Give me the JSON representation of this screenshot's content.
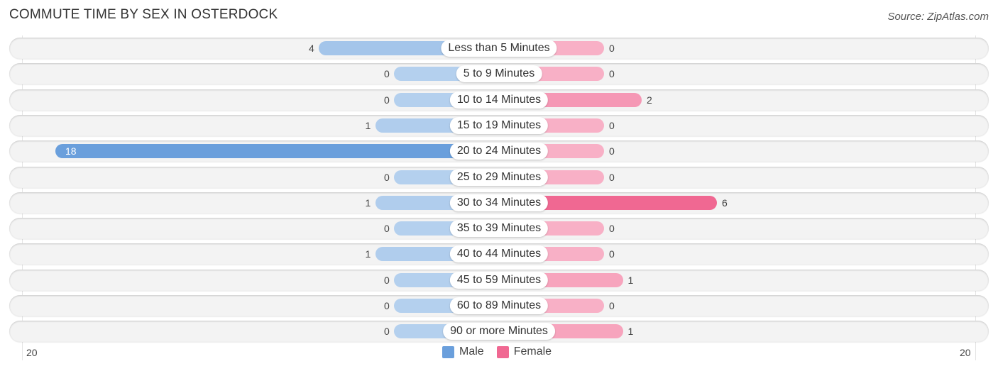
{
  "title": "COMMUTE TIME BY SEX IN OSTERDOCK",
  "source": "Source: ZipAtlas.com",
  "chart_data": {
    "type": "bar",
    "orientation": "horizontal-diverging",
    "title": "COMMUTE TIME BY SEX IN OSTERDOCK",
    "categories": [
      "Less than 5 Minutes",
      "5 to 9 Minutes",
      "10 to 14 Minutes",
      "15 to 19 Minutes",
      "20 to 24 Minutes",
      "25 to 29 Minutes",
      "30 to 34 Minutes",
      "35 to 39 Minutes",
      "40 to 44 Minutes",
      "45 to 59 Minutes",
      "60 to 89 Minutes",
      "90 or more Minutes"
    ],
    "series": [
      {
        "name": "Male",
        "color": "#6a9fdc",
        "values": [
          4,
          0,
          0,
          1,
          18,
          0,
          1,
          0,
          1,
          0,
          0,
          0
        ]
      },
      {
        "name": "Female",
        "color": "#f06892",
        "values": [
          0,
          0,
          2,
          0,
          0,
          0,
          6,
          0,
          0,
          1,
          0,
          1
        ]
      }
    ],
    "axis_min_label": "20",
    "axis_max_label": "20",
    "xlim": [
      -20,
      20
    ],
    "legend": [
      "Male",
      "Female"
    ],
    "legend_position": "bottom-center"
  }
}
